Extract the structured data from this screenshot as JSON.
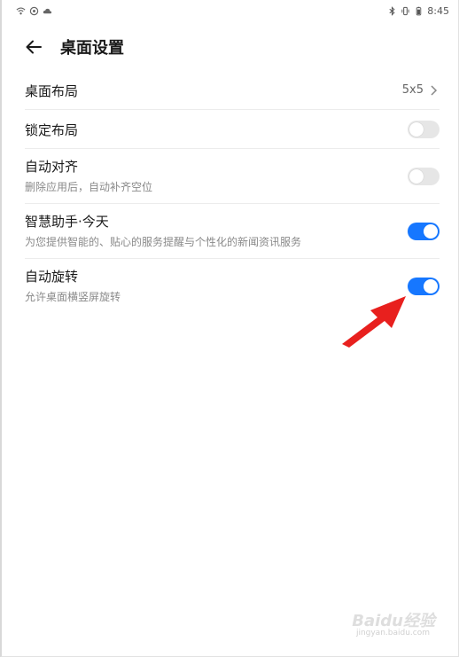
{
  "status_bar": {
    "time": "8:45",
    "left_icons": [
      "wifi-icon",
      "sync-icon",
      "cloud-icon"
    ],
    "right_icons": [
      "bluetooth-icon",
      "vibrate-icon",
      "battery-icon"
    ]
  },
  "header": {
    "title": "桌面设置",
    "back_icon": "arrow-left-icon"
  },
  "settings": [
    {
      "title": "桌面布局",
      "value": "5x5",
      "control": "chevron"
    },
    {
      "title": "锁定布局",
      "control": "toggle",
      "state": "off"
    },
    {
      "title": "自动对齐",
      "subtitle": "删除应用后，自动补齐空位",
      "control": "toggle",
      "state": "off"
    },
    {
      "title": "智慧助手·今天",
      "subtitle": "为您提供智能的、贴心的服务提醒与个性化的新闻资讯服务",
      "control": "toggle",
      "state": "on"
    },
    {
      "title": "自动旋转",
      "subtitle": "允许桌面横竖屏旋转",
      "control": "toggle",
      "state": "on"
    }
  ],
  "colors": {
    "toggle_on": "#1677ff",
    "toggle_off": "#e6e6e6",
    "annotation_arrow": "#e8201e"
  },
  "watermark": {
    "main": "Baidu经验",
    "sub": "jingyan.baidu.com"
  }
}
